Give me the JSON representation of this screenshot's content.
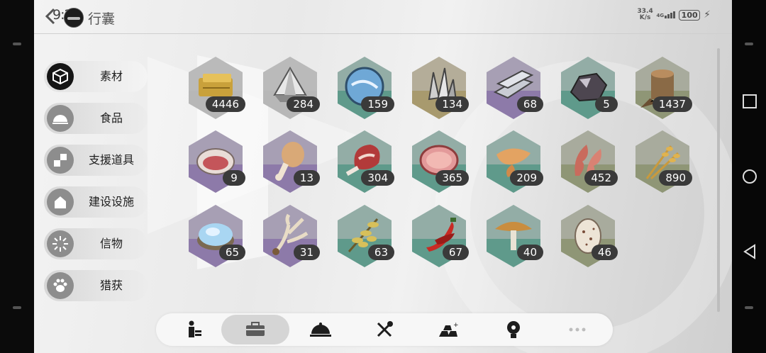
{
  "status_bar": {
    "time": "9:22",
    "net_speed_value": "33.4",
    "net_speed_unit": "K/s",
    "network": "4G",
    "battery": "100"
  },
  "header": {
    "title": "行囊"
  },
  "categories": [
    {
      "label": "素材",
      "icon": "cube-icon",
      "active": true
    },
    {
      "label": "食品",
      "icon": "cloche-icon",
      "active": false
    },
    {
      "label": "支援道具",
      "icon": "blocks-icon",
      "active": false
    },
    {
      "label": "建设设施",
      "icon": "house-icon",
      "active": false
    },
    {
      "label": "信物",
      "icon": "burst-icon",
      "active": false
    },
    {
      "label": "猎获",
      "icon": "paw-icon",
      "active": false
    }
  ],
  "items": [
    {
      "name": "gold-ingot",
      "count": "4446",
      "tint": "#b7b7b7",
      "art": "gold-bar-icon"
    },
    {
      "name": "crystal-shard",
      "count": "284",
      "tint": "#b7b7b7",
      "art": "crystal-icon"
    },
    {
      "name": "blue-orb",
      "count": "159",
      "tint": "#5f9a8b",
      "art": "orb-icon"
    },
    {
      "name": "quartz",
      "count": "134",
      "tint": "#a89a6e",
      "art": "quartz-icon"
    },
    {
      "name": "iron-bars",
      "count": "68",
      "tint": "#8d7aa9",
      "art": "bars-icon"
    },
    {
      "name": "dark-ore",
      "count": "5",
      "tint": "#5f9a8b",
      "art": "ore-icon"
    },
    {
      "name": "tree-stump",
      "count": "1437",
      "tint": "#8f9676",
      "art": "stump-icon"
    },
    {
      "name": "shell",
      "count": "9",
      "tint": "#8d7aa9",
      "art": "shell-icon"
    },
    {
      "name": "drumstick",
      "count": "13",
      "tint": "#8d7aa9",
      "art": "drumstick-icon"
    },
    {
      "name": "ribs",
      "count": "304",
      "tint": "#5f9a8b",
      "art": "ribs-icon"
    },
    {
      "name": "ham",
      "count": "365",
      "tint": "#5f9a8b",
      "art": "ham-icon"
    },
    {
      "name": "chicken-wing",
      "count": "209",
      "tint": "#5f9a8b",
      "art": "wing-icon"
    },
    {
      "name": "crab-claw",
      "count": "452",
      "tint": "#8f9676",
      "art": "claw-icon"
    },
    {
      "name": "wheat",
      "count": "890",
      "tint": "#8f9676",
      "art": "wheat-icon"
    },
    {
      "name": "salt-bowl",
      "count": "65",
      "tint": "#8d7aa9",
      "art": "salt-icon"
    },
    {
      "name": "antler",
      "count": "31",
      "tint": "#8d7aa9",
      "art": "antler-icon"
    },
    {
      "name": "herb",
      "count": "63",
      "tint": "#5f9a8b",
      "art": "herb-icon"
    },
    {
      "name": "chili",
      "count": "67",
      "tint": "#5f9a8b",
      "art": "chili-icon"
    },
    {
      "name": "mushroom",
      "count": "40",
      "tint": "#5f9a8b",
      "art": "mushroom-icon"
    },
    {
      "name": "egg",
      "count": "46",
      "tint": "#8f9676",
      "art": "egg-icon"
    }
  ],
  "tabs": [
    {
      "icon": "character-icon",
      "active": false
    },
    {
      "icon": "toolbox-icon",
      "active": true
    },
    {
      "icon": "cloche-icon",
      "active": false
    },
    {
      "icon": "tools-icon",
      "active": false
    },
    {
      "icon": "ingots-icon",
      "active": false
    },
    {
      "icon": "bulb-icon",
      "active": false
    },
    {
      "icon": "more-icon",
      "active": false
    }
  ],
  "colors": {
    "badge_bg": "#3a3a3a",
    "tint_gray": "#b7b7b7",
    "tint_teal": "#5f9a8b",
    "tint_purple": "#8d7aa9",
    "tint_olive": "#8f9676",
    "tint_gold": "#a89a6e"
  }
}
